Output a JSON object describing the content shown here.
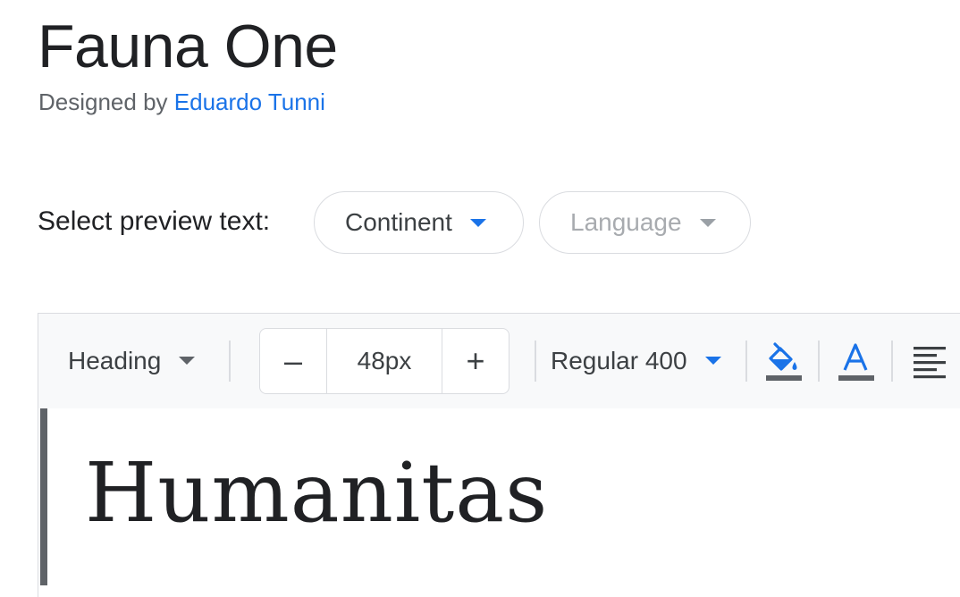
{
  "header": {
    "font_name": "Fauna One",
    "designed_by_prefix": "Designed by ",
    "designer_name": "Eduardo Tunni"
  },
  "preview_controls": {
    "label": "Select preview text:",
    "continent_label": "Continent",
    "language_label": "Language"
  },
  "toolbar": {
    "style_label": "Heading",
    "size_decrement": "–",
    "size_value": "48px",
    "size_increment": "+",
    "weight_label": "Regular 400",
    "icons": [
      "paint-bucket-icon",
      "text-color-icon",
      "align-left-icon"
    ]
  },
  "preview": {
    "text": "Humanitas"
  },
  "colors": {
    "accent": "#1a73e8",
    "text": "#202124",
    "muted": "#5f6368",
    "border": "#dadce0",
    "toolbar_bg": "#f8f9fa"
  }
}
